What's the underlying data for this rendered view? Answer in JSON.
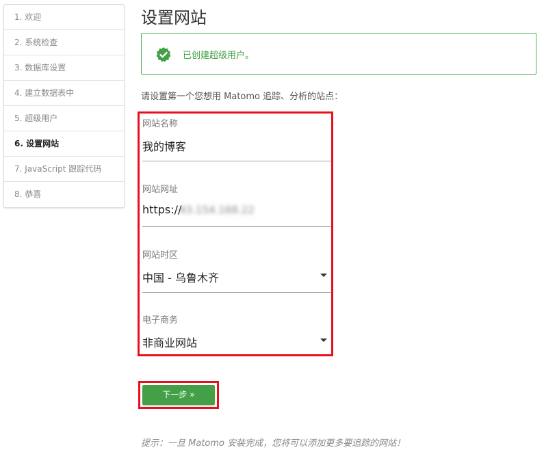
{
  "sidebar": {
    "steps": [
      {
        "label": "1. 欢迎"
      },
      {
        "label": "2. 系统检查"
      },
      {
        "label": "3. 数据库设置"
      },
      {
        "label": "4. 建立数据表中"
      },
      {
        "label": "5. 超级用户"
      },
      {
        "label": "6. 设置网站"
      },
      {
        "label": "7. JavaScript 跟踪代码"
      },
      {
        "label": "8. 恭喜"
      }
    ],
    "active_step": "6. 设置网站"
  },
  "main": {
    "title": "设置网站",
    "alert": {
      "text": "已创建超级用户。",
      "icon": "check-badge-icon",
      "color": "#43a047"
    },
    "intro": "请设置第一个您想用 Matomo 追踪、分析的站点：",
    "form": {
      "site_name": {
        "label": "网站名称",
        "value": "我的博客"
      },
      "site_url": {
        "label": "网站网址",
        "value_prefix": "https://",
        "value_blurred": "43.154.168.22"
      },
      "timezone": {
        "label": "网站时区",
        "value": "中国 - 乌鲁木齐"
      },
      "ecommerce": {
        "label": "电子商务",
        "value": "非商业网站"
      }
    },
    "next_button": {
      "label": "下一步 »",
      "color": "#43a047"
    },
    "tip": "提示：一旦 Matomo 安装完成，您将可以添加更多要追踪的网站！"
  },
  "colors": {
    "highlight": "#e8101a",
    "accent": "#43a047"
  }
}
